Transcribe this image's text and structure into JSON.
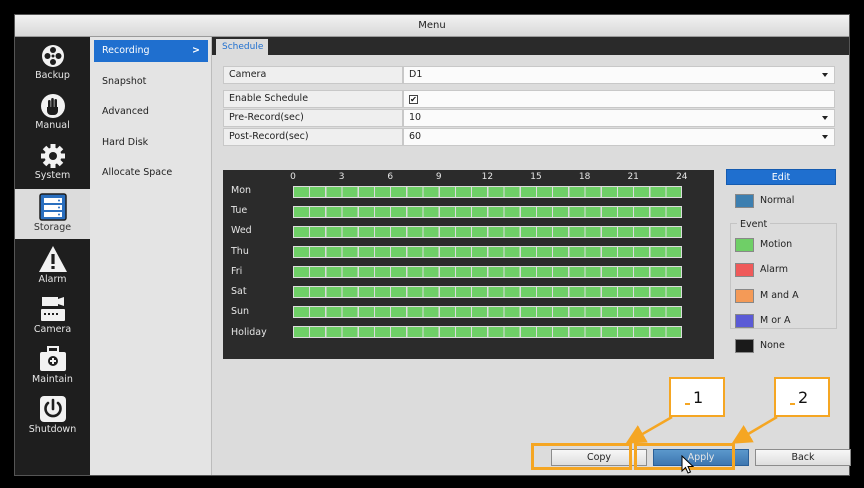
{
  "window": {
    "title": "Menu"
  },
  "leftnav": {
    "items": [
      {
        "label": "Backup",
        "icon": "film-reel-icon",
        "active": false
      },
      {
        "label": "Manual",
        "icon": "hand-icon",
        "active": false
      },
      {
        "label": "System",
        "icon": "gear-icon",
        "active": false
      },
      {
        "label": "Storage",
        "icon": "storage-icon",
        "active": true
      },
      {
        "label": "Alarm",
        "icon": "warning-icon",
        "active": false
      },
      {
        "label": "Camera",
        "icon": "camera-icon",
        "active": false
      },
      {
        "label": "Maintain",
        "icon": "toolbox-icon",
        "active": false
      },
      {
        "label": "Shutdown",
        "icon": "power-icon",
        "active": false
      }
    ]
  },
  "submenu": {
    "items": [
      {
        "label": "Recording",
        "active": true,
        "chevron": ">"
      },
      {
        "label": "Snapshot",
        "active": false
      },
      {
        "label": "Advanced",
        "active": false
      },
      {
        "label": "Hard Disk",
        "active": false
      },
      {
        "label": "Allocate Space",
        "active": false
      }
    ]
  },
  "tabs": [
    {
      "label": "Schedule",
      "active": true
    }
  ],
  "form": {
    "camera": {
      "label": "Camera",
      "value": "D1"
    },
    "enable_schedule": {
      "label": "Enable Schedule",
      "checked": true,
      "check_glyph": "✔"
    },
    "pre_record": {
      "label": "Pre-Record(sec)",
      "value": "10"
    },
    "post_record": {
      "label": "Post-Record(sec)",
      "value": "60"
    }
  },
  "schedule": {
    "hours": [
      "0",
      "3",
      "6",
      "9",
      "12",
      "15",
      "18",
      "21",
      "24"
    ],
    "days": [
      "Mon",
      "Tue",
      "Wed",
      "Thu",
      "Fri",
      "Sat",
      "Sun",
      "Holiday"
    ],
    "fill_color": "#6fcf67",
    "coverage_hours": 24
  },
  "legend": {
    "edit_label": "Edit",
    "normal": {
      "label": "Normal",
      "color": "#3d7fb0"
    },
    "event_title": "Event",
    "events": [
      {
        "label": "Motion",
        "color": "#6fcf67"
      },
      {
        "label": "Alarm",
        "color": "#ef5a5a"
      },
      {
        "label": "M and A",
        "color": "#f49a57"
      },
      {
        "label": "M or A",
        "color": "#5b5bd6"
      },
      {
        "label": "None",
        "color": "#1a1a1a"
      }
    ]
  },
  "buttons": {
    "copy": "Copy",
    "apply": "Apply",
    "back": "Back"
  },
  "annotations": {
    "callout_1": "1",
    "callout_2": "2",
    "highlight_color": "#f5a623"
  },
  "colors": {
    "accent": "#1f6fcf",
    "nav_bg": "#1e1e1e",
    "panel_bg": "#dcdcdc"
  }
}
